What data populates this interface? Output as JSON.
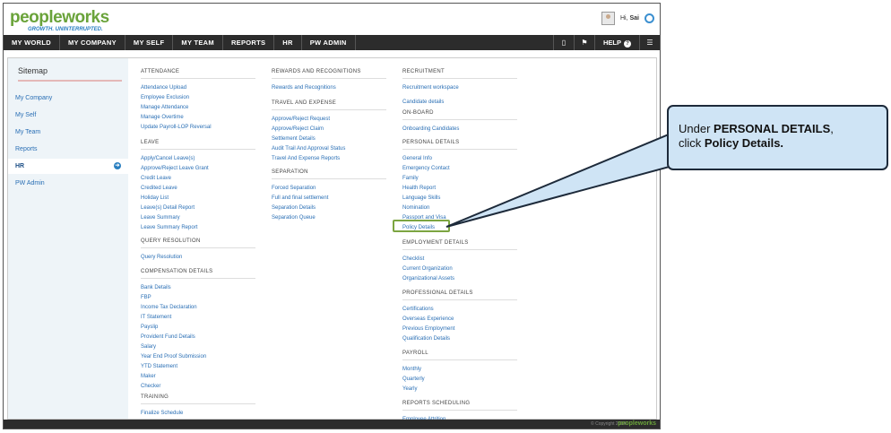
{
  "app": {
    "logo_main": "peopleworks",
    "logo_tagline": "GROWTH. UNINTERRUPTED.",
    "greeting": "Hi,",
    "user_name": "Sai"
  },
  "nav": {
    "items": [
      "MY WORLD",
      "MY COMPANY",
      "MY SELF",
      "MY TEAM",
      "REPORTS",
      "HR",
      "PW ADMIN"
    ],
    "help_label": "HELP",
    "help_icon": "?"
  },
  "sidebar": {
    "title": "Sitemap",
    "items": [
      {
        "label": "My Company"
      },
      {
        "label": "My Self"
      },
      {
        "label": "My Team"
      },
      {
        "label": "Reports"
      },
      {
        "label": "HR",
        "active": true
      },
      {
        "label": "PW Admin"
      }
    ],
    "arrow_icon": "arrow-right-circle-icon"
  },
  "columns": {
    "col1": {
      "sections": [
        {
          "title": "ATTENDANCE",
          "links": [
            "Attendance Upload",
            "Employee Exclusion",
            "Manage Attendance",
            "Manage Overtime",
            "Update Payroll-LOP Reversal"
          ]
        },
        {
          "title": "LEAVE",
          "links": [
            "Apply/Cancel Leave(s)",
            "Approve/Reject Leave Grant",
            "Credit Leave",
            "Credited Leave",
            "Holiday List",
            "Leave(s) Detail Report",
            "Leave Summary",
            "Leave Summary Report"
          ]
        },
        {
          "title": "QUERY RESOLUTION",
          "links": [
            "Query Resolution"
          ]
        },
        {
          "title": "COMPENSATION DETAILS",
          "links": [
            "Bank Details",
            "FBP",
            "Income Tax Declaration",
            "IT Statement",
            "Payslip",
            "Provident Fund Details",
            "Salary",
            "Year End Proof Submission",
            "YTD Statement",
            "Maker",
            "Checker"
          ]
        },
        {
          "title": "TRAINING",
          "links": [
            "Finalize Schedule"
          ]
        }
      ]
    },
    "col2": {
      "sections": [
        {
          "title": "REWARDS AND RECOGNITIONS",
          "links": [
            "Rewards and Recognitions"
          ]
        },
        {
          "title": "TRAVEL AND EXPENSE",
          "links": [
            "Approve/Reject Request",
            "Approve/Reject Claim",
            "Settlement Details",
            "Audit Trail And Approval Status",
            "Travel And Expense Reports"
          ]
        },
        {
          "title": "SEPARATION",
          "links": [
            "Forced Separation",
            "Full and final settlement",
            "Separation Details",
            "Separation Queue"
          ]
        }
      ]
    },
    "col3": {
      "sections": [
        {
          "title": "RECRUITMENT",
          "links": [
            "Recruitment workspace",
            "Candidate details"
          ]
        },
        {
          "title": "ON-BOARD",
          "links": [
            "Onboarding Candidates"
          ]
        },
        {
          "title": "PERSONAL DETAILS",
          "links": [
            "General Info",
            "Emergency Contact",
            "Family",
            "Health Report",
            "Language Skills",
            "Nomination",
            "Passport and Visa",
            "Policy Details"
          ]
        },
        {
          "title": "EMPLOYMENT DETAILS",
          "links": [
            "Checklist",
            "Current Organization",
            "Organizational Assets"
          ]
        },
        {
          "title": "PROFESSIONAL DETAILS",
          "links": [
            "Certifications",
            "Overseas Experience",
            "Previous Employment",
            "Qualification Details"
          ]
        },
        {
          "title": "PAYROLL",
          "links": [
            "Monthly",
            "Quarterly",
            "Yearly"
          ]
        },
        {
          "title": "REPORTS SCHEDULING",
          "links": [
            "Employee Attrition"
          ]
        }
      ]
    }
  },
  "footer": {
    "copyright": "© Copyright 2014",
    "logo": "peopleworks"
  },
  "callout": {
    "prefix": "Under ",
    "section": "PERSONAL DETAILS",
    "middle": ",",
    "line2_prefix": "click ",
    "target": "Policy Details.",
    "suffix": ""
  },
  "colors": {
    "nav_bg": "#2c2c2c",
    "link": "#2a6fb5",
    "highlight": "#7ca541",
    "callout_bg": "#cfe4f5",
    "logo_green": "#6aa33a",
    "logo_blue": "#2a7fc0"
  }
}
